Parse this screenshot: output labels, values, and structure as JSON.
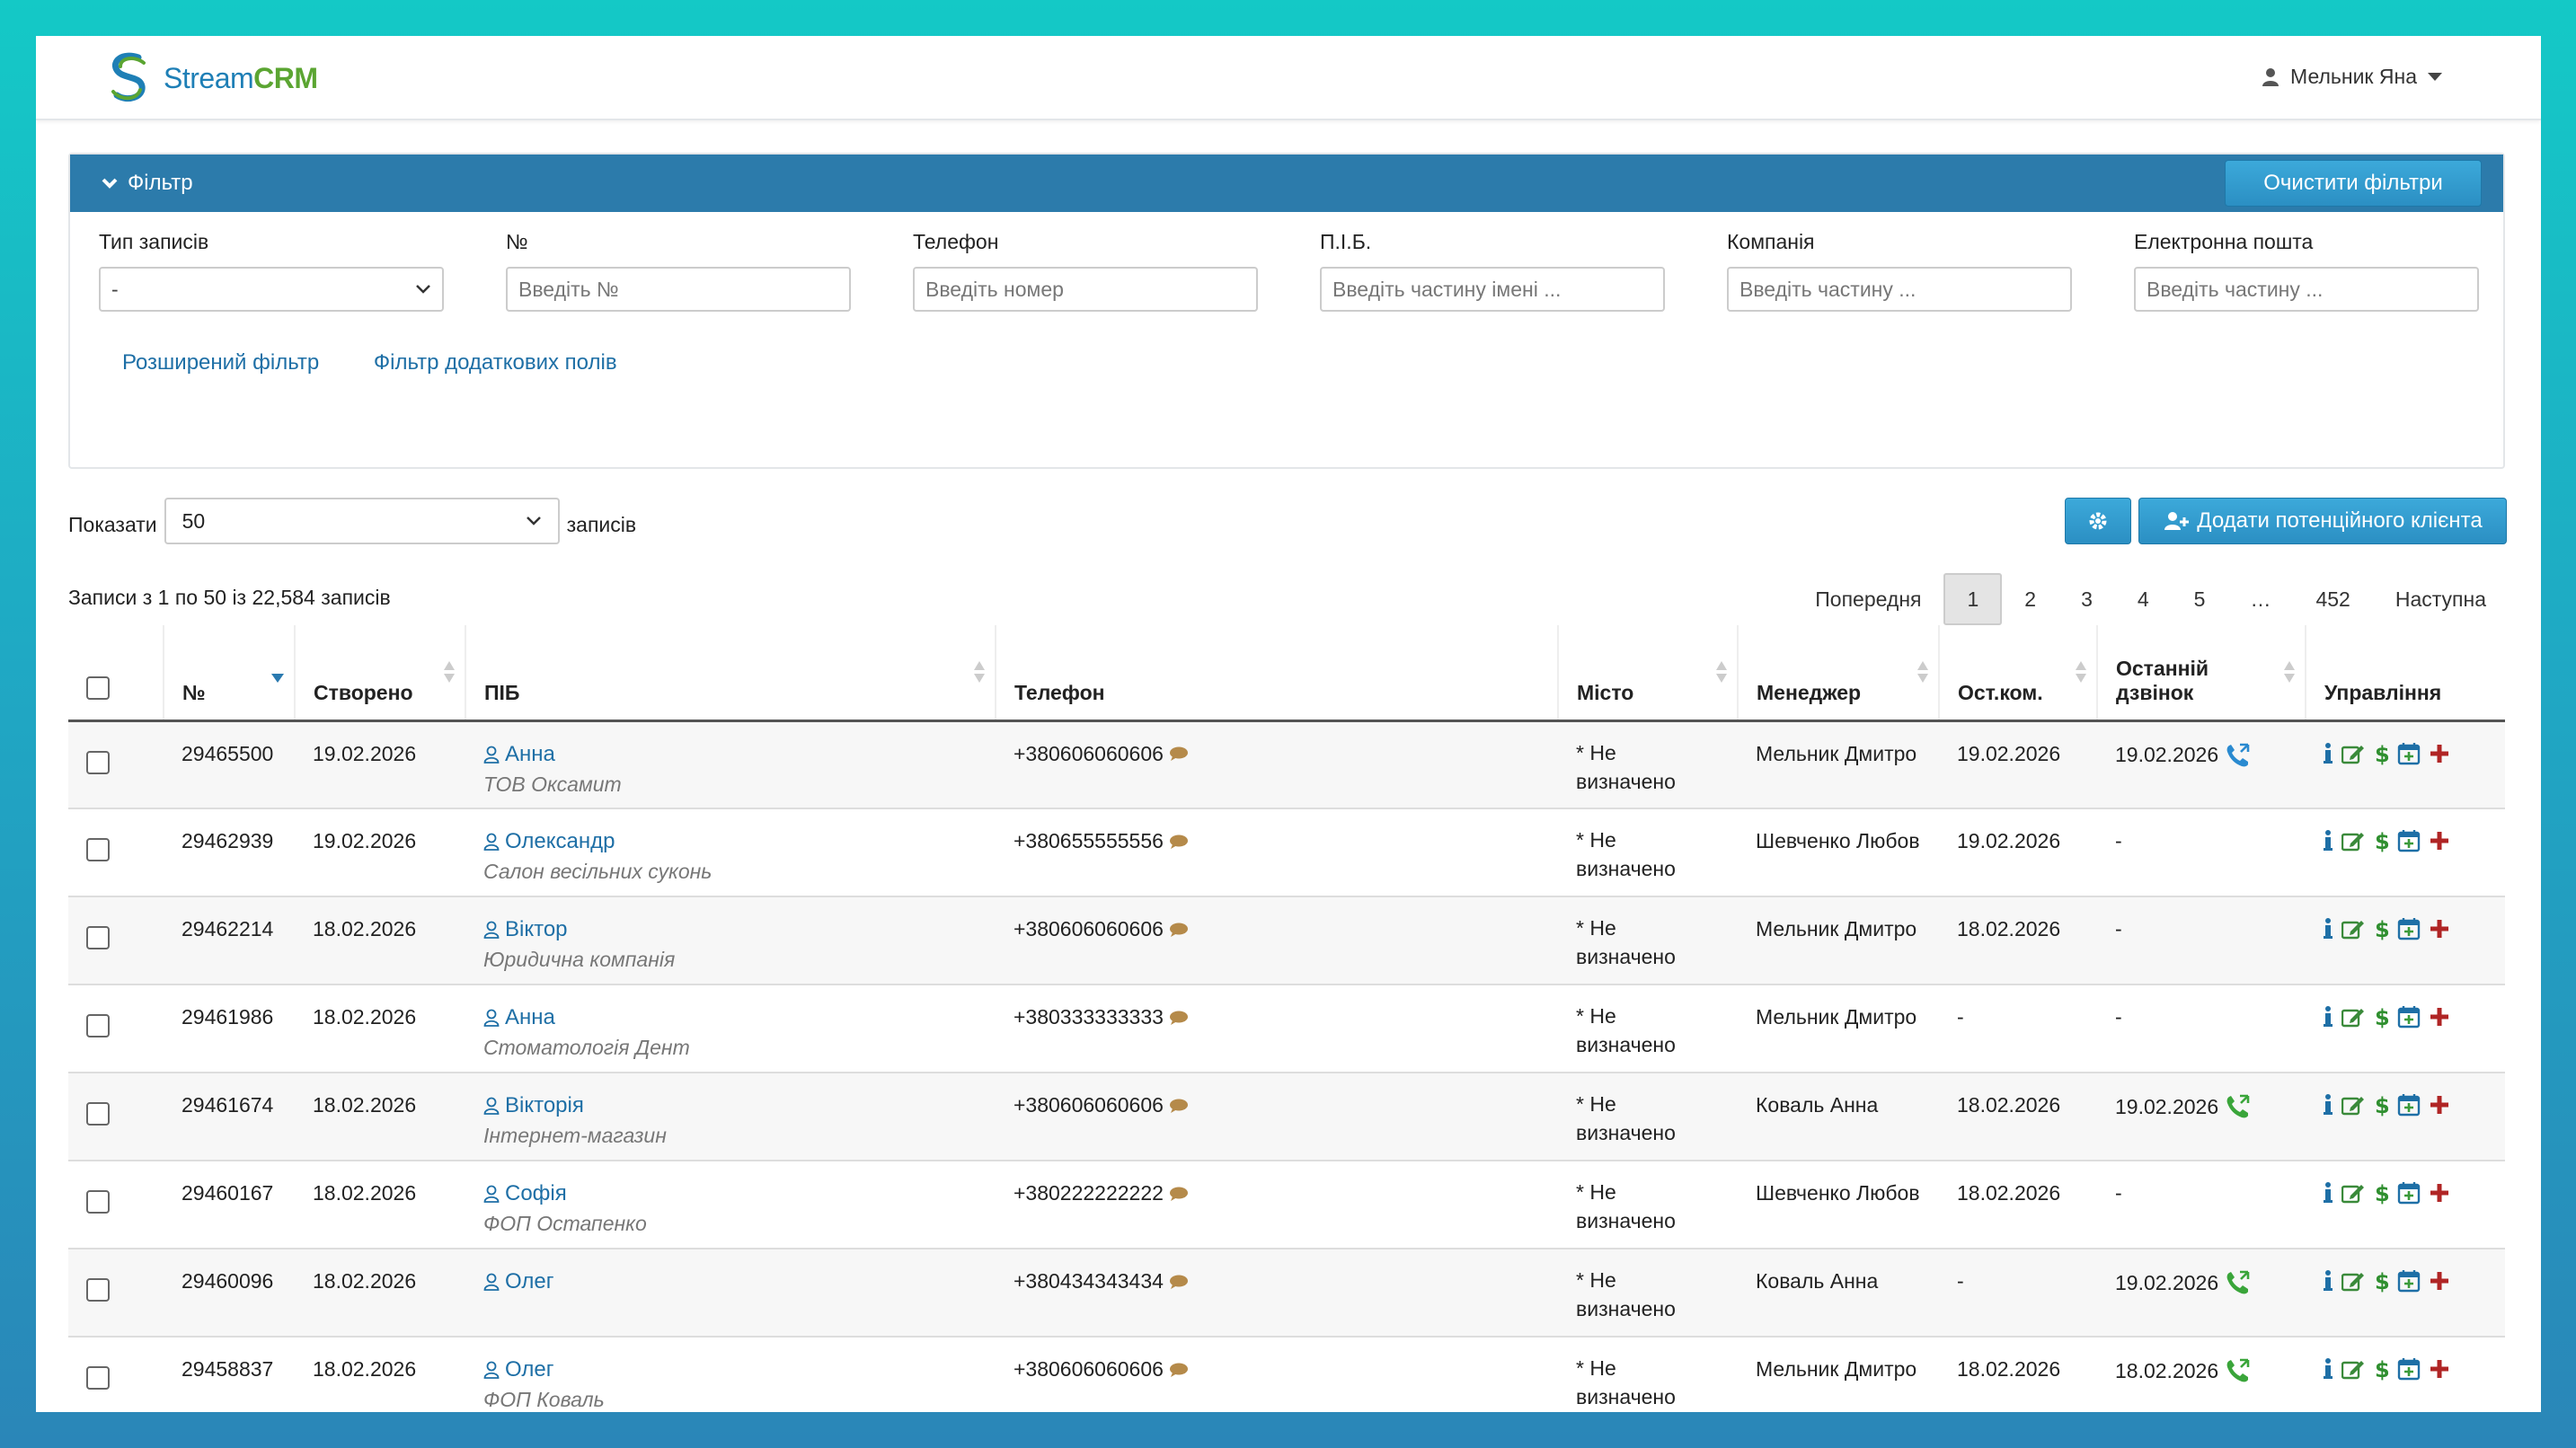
{
  "header": {
    "brand_a": "Stream",
    "brand_b": "CRM",
    "user": "Мельник Яна"
  },
  "filter": {
    "title": "Фільтр",
    "clear_button": "Очистити фільтри",
    "fields": [
      {
        "label": "Тип записів",
        "value": "-"
      },
      {
        "label": "№",
        "placeholder": "Введіть №"
      },
      {
        "label": "Телефон",
        "placeholder": "Введіть номер"
      },
      {
        "label": "П.І.Б.",
        "placeholder": "Введіть частину імені ..."
      },
      {
        "label": "Компанія",
        "placeholder": "Введіть частину ..."
      },
      {
        "label": "Електронна пошта",
        "placeholder": "Введіть частину ..."
      }
    ],
    "advanced_link": "Розширений фільтр",
    "extra_fields_link": "Фільтр додаткових полів"
  },
  "controls": {
    "show_label": "Показати",
    "show_value": "50",
    "records_label": "записів",
    "add_button": "Додати потенційного клієнта",
    "records_info": "Записи з 1 по 50 із 22,584 записів"
  },
  "pager": {
    "prev": "Попередня",
    "pages": [
      "1",
      "2",
      "3",
      "4",
      "5",
      "…",
      "452"
    ],
    "next": "Наступна"
  },
  "table": {
    "headers": {
      "num": "№",
      "created": "Створено",
      "pib": "ПІБ",
      "phone": "Телефон",
      "city": "Місто",
      "manager": "Менеджер",
      "lastcomm": "Ост.ком.",
      "lastcall_1": "Останній",
      "lastcall_2": "дзвінок",
      "manage": "Управління"
    },
    "rows": [
      {
        "num": "29465500",
        "created": "19.02.2026",
        "name": "Анна",
        "company": "ТОВ Оксамит",
        "phone": "+380606060606",
        "city_1": "* Не",
        "city_2": "визначено",
        "manager": "Мельник Дмитро",
        "lastcomm": "19.02.2026",
        "lastcall": "19.02.2026"
      },
      {
        "num": "29462939",
        "created": "19.02.2026",
        "name": "Олександр",
        "company": "Салон весільних суконь",
        "phone": "+380655555556",
        "city_1": "* Не",
        "city_2": "визначено",
        "manager": "Шевченко Любов",
        "lastcomm": "19.02.2026",
        "lastcall": "-"
      },
      {
        "num": "29462214",
        "created": "18.02.2026",
        "name": "Віктор",
        "company": "Юридична компанія",
        "phone": "+380606060606",
        "city_1": "* Не",
        "city_2": "визначено",
        "manager": "Мельник Дмитро",
        "lastcomm": "18.02.2026",
        "lastcall": "-"
      },
      {
        "num": "29461986",
        "created": "18.02.2026",
        "name": "Анна",
        "company": "Стоматологія Дент",
        "phone": "+380333333333",
        "city_1": "* Не",
        "city_2": "визначено",
        "manager": "Мельник Дмитро",
        "lastcomm": "-",
        "lastcall": "-"
      },
      {
        "num": "29461674",
        "created": "18.02.2026",
        "name": "Вікторія",
        "company": "Інтернет-магазин",
        "phone": "+380606060606",
        "city_1": "* Не",
        "city_2": "визначено",
        "manager": "Коваль Анна",
        "lastcomm": "18.02.2026",
        "lastcall": "19.02.2026"
      },
      {
        "num": "29460167",
        "created": "18.02.2026",
        "name": "Софія",
        "company": "ФОП Остапенко",
        "phone": "+380222222222",
        "city_1": "* Не",
        "city_2": "визначено",
        "manager": "Шевченко Любов",
        "lastcomm": "18.02.2026",
        "lastcall": "-"
      },
      {
        "num": "29460096",
        "created": "18.02.2026",
        "name": "Олег",
        "company": "",
        "phone": "+380434343434",
        "city_1": "* Не",
        "city_2": "визначено",
        "manager": "Коваль Анна",
        "lastcomm": "-",
        "lastcall": "19.02.2026"
      },
      {
        "num": "29458837",
        "created": "18.02.2026",
        "name": "Олег",
        "company": "ФОП Коваль",
        "phone": "+380606060606",
        "city_1": "* Не",
        "city_2": "визначено",
        "manager": "Мельник Дмитро",
        "lastcomm": "18.02.2026",
        "lastcall": "18.02.2026"
      }
    ]
  },
  "icons": {
    "user": "user-icon",
    "chat": "chat-bubble-icon",
    "call_in": "phone-incoming-icon",
    "call_out": "phone-outgoing-icon",
    "info": "info-icon",
    "edit": "edit-icon",
    "deal": "dollar-icon",
    "calendar": "calendar-add-icon",
    "add": "plus-icon"
  },
  "colors": {
    "accent": "#2c7bab",
    "link": "#1e6fa6",
    "brand_green": "#5ba532",
    "call_green": "#3aa53a",
    "call_blue": "#2a8ad0",
    "chat": "#b58a4a",
    "plus_red": "#b02525"
  }
}
